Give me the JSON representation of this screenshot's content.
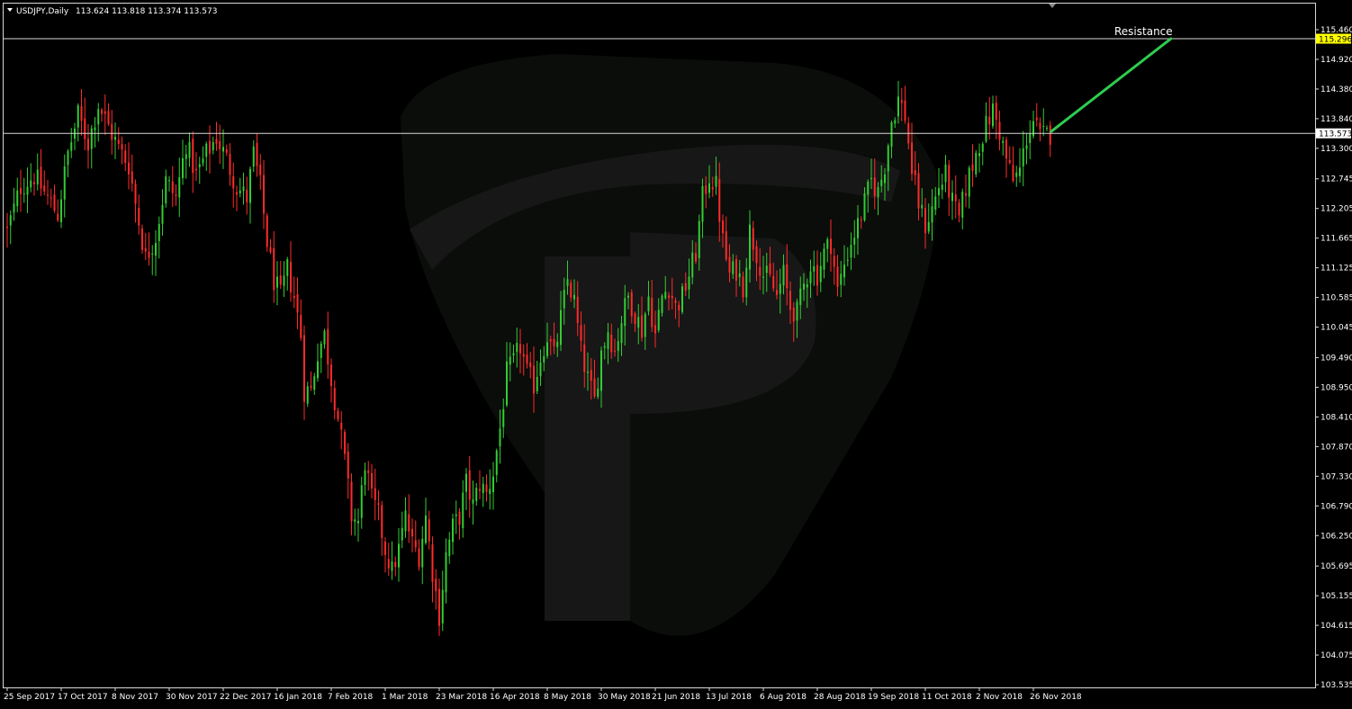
{
  "header": {
    "symbol_label": "USDJPY,Daily",
    "ohlc": "113.624 113.818 113.374 113.573"
  },
  "colors": {
    "background": "#000000",
    "frame": "#d8d8d8",
    "bull": "#32cd32",
    "bear": "#ff2a2a",
    "hline": "#d8d8d8",
    "arrow": "#2ecc4f",
    "resistance_tag_bg": "#ffff00",
    "current_tag_bg": "#ffffff",
    "watermark": "#171717"
  },
  "icons": {
    "menu": "triangle-down-icon",
    "shift_marker": "triangle-down-icon"
  },
  "chart_data": {
    "type": "candlestick",
    "title": "USDJPY,Daily",
    "ylim": [
      103.535,
      115.46
    ],
    "y_ticks": [
      "115.460",
      "114.920",
      "114.380",
      "113.840",
      "113.300",
      "112.745",
      "112.205",
      "111.665",
      "111.125",
      "110.585",
      "110.045",
      "109.490",
      "108.950",
      "108.410",
      "107.870",
      "107.330",
      "106.790",
      "106.250",
      "105.695",
      "105.155",
      "104.615",
      "104.075",
      "103.535"
    ],
    "x_tick_labels": [
      "25 Sep 2017",
      "17 Oct 2017",
      "8 Nov 2017",
      "30 Nov 2017",
      "22 Dec 2017",
      "16 Jan 2018",
      "7 Feb 2018",
      "1 Mar 2018",
      "23 Mar 2018",
      "16 Apr 2018",
      "8 May 2018",
      "30 May 2018",
      "21 Jun 2018",
      "13 Jul 2018",
      "6 Aug 2018",
      "28 Aug 2018",
      "19 Sep 2018",
      "11 Oct 2018",
      "2 Nov 2018",
      "26 Nov 2018"
    ],
    "x_tick_bar_index": [
      0,
      16,
      32,
      48,
      64,
      80,
      96,
      112,
      128,
      144,
      160,
      176,
      192,
      208,
      224,
      240,
      256,
      272,
      288,
      304
    ],
    "bar_count": 310,
    "anchors": [
      {
        "i": 0,
        "c": 111.8
      },
      {
        "i": 4,
        "c": 112.6
      },
      {
        "i": 8,
        "c": 112.8
      },
      {
        "i": 12,
        "c": 112.4
      },
      {
        "i": 15,
        "c": 112.1
      },
      {
        "i": 18,
        "c": 113.2
      },
      {
        "i": 21,
        "c": 113.9
      },
      {
        "i": 24,
        "c": 113.4
      },
      {
        "i": 27,
        "c": 114.1
      },
      {
        "i": 30,
        "c": 113.7
      },
      {
        "i": 33,
        "c": 113.3
      },
      {
        "i": 36,
        "c": 113.0
      },
      {
        "i": 38,
        "c": 112.3
      },
      {
        "i": 41,
        "c": 111.3
      },
      {
        "i": 44,
        "c": 111.7
      },
      {
        "i": 47,
        "c": 112.7
      },
      {
        "i": 50,
        "c": 112.4
      },
      {
        "i": 53,
        "c": 113.4
      },
      {
        "i": 56,
        "c": 112.8
      },
      {
        "i": 59,
        "c": 113.2
      },
      {
        "i": 62,
        "c": 113.5
      },
      {
        "i": 65,
        "c": 113.1
      },
      {
        "i": 68,
        "c": 112.6
      },
      {
        "i": 71,
        "c": 112.4
      },
      {
        "i": 73,
        "c": 113.2
      },
      {
        "i": 75,
        "c": 112.6
      },
      {
        "i": 77,
        "c": 111.6
      },
      {
        "i": 79,
        "c": 110.9
      },
      {
        "i": 81,
        "c": 110.6
      },
      {
        "i": 83,
        "c": 111.1
      },
      {
        "i": 85,
        "c": 110.6
      },
      {
        "i": 87,
        "c": 109.9
      },
      {
        "i": 88,
        "c": 108.9
      },
      {
        "i": 90,
        "c": 108.9
      },
      {
        "i": 92,
        "c": 109.6
      },
      {
        "i": 94,
        "c": 109.9
      },
      {
        "i": 96,
        "c": 109.1
      },
      {
        "i": 98,
        "c": 108.4
      },
      {
        "i": 100,
        "c": 107.6
      },
      {
        "i": 102,
        "c": 106.6
      },
      {
        "i": 104,
        "c": 106.5
      },
      {
        "i": 106,
        "c": 107.6
      },
      {
        "i": 108,
        "c": 106.9
      },
      {
        "i": 110,
        "c": 106.6
      },
      {
        "i": 112,
        "c": 106.0
      },
      {
        "i": 114,
        "c": 105.6
      },
      {
        "i": 116,
        "c": 106.0
      },
      {
        "i": 118,
        "c": 106.6
      },
      {
        "i": 120,
        "c": 106.1
      },
      {
        "i": 122,
        "c": 105.9
      },
      {
        "i": 124,
        "c": 106.6
      },
      {
        "i": 126,
        "c": 105.6
      },
      {
        "i": 128,
        "c": 104.8
      },
      {
        "i": 130,
        "c": 105.9
      },
      {
        "i": 132,
        "c": 106.4
      },
      {
        "i": 134,
        "c": 106.6
      },
      {
        "i": 136,
        "c": 107.2
      },
      {
        "i": 138,
        "c": 106.8
      },
      {
        "i": 140,
        "c": 107.2
      },
      {
        "i": 142,
        "c": 107.0
      },
      {
        "i": 144,
        "c": 107.4
      },
      {
        "i": 146,
        "c": 108.2
      },
      {
        "i": 148,
        "c": 109.2
      },
      {
        "i": 150,
        "c": 109.4
      },
      {
        "i": 152,
        "c": 109.7
      },
      {
        "i": 154,
        "c": 109.2
      },
      {
        "i": 156,
        "c": 109.0
      },
      {
        "i": 158,
        "c": 109.5
      },
      {
        "i": 160,
        "c": 109.9
      },
      {
        "i": 162,
        "c": 109.5
      },
      {
        "i": 164,
        "c": 110.2
      },
      {
        "i": 166,
        "c": 110.9
      },
      {
        "i": 168,
        "c": 110.5
      },
      {
        "i": 170,
        "c": 109.6
      },
      {
        "i": 172,
        "c": 109.1
      },
      {
        "i": 174,
        "c": 108.7
      },
      {
        "i": 176,
        "c": 109.6
      },
      {
        "i": 178,
        "c": 110.0
      },
      {
        "i": 180,
        "c": 109.6
      },
      {
        "i": 182,
        "c": 110.2
      },
      {
        "i": 184,
        "c": 110.6
      },
      {
        "i": 186,
        "c": 110.3
      },
      {
        "i": 188,
        "c": 110.0
      },
      {
        "i": 190,
        "c": 110.6
      },
      {
        "i": 192,
        "c": 109.9
      },
      {
        "i": 194,
        "c": 110.6
      },
      {
        "i": 196,
        "c": 110.8
      },
      {
        "i": 198,
        "c": 110.4
      },
      {
        "i": 200,
        "c": 110.6
      },
      {
        "i": 202,
        "c": 111.0
      },
      {
        "i": 204,
        "c": 111.4
      },
      {
        "i": 206,
        "c": 112.4
      },
      {
        "i": 208,
        "c": 112.8
      },
      {
        "i": 210,
        "c": 112.6
      },
      {
        "i": 212,
        "c": 111.6
      },
      {
        "i": 214,
        "c": 111.0
      },
      {
        "i": 216,
        "c": 111.1
      },
      {
        "i": 218,
        "c": 110.8
      },
      {
        "i": 220,
        "c": 111.8
      },
      {
        "i": 222,
        "c": 111.4
      },
      {
        "i": 224,
        "c": 111.0
      },
      {
        "i": 226,
        "c": 110.9
      },
      {
        "i": 228,
        "c": 110.6
      },
      {
        "i": 230,
        "c": 111.0
      },
      {
        "i": 232,
        "c": 110.4
      },
      {
        "i": 234,
        "c": 110.3
      },
      {
        "i": 236,
        "c": 110.8
      },
      {
        "i": 238,
        "c": 111.2
      },
      {
        "i": 240,
        "c": 111.0
      },
      {
        "i": 242,
        "c": 111.4
      },
      {
        "i": 244,
        "c": 111.6
      },
      {
        "i": 246,
        "c": 110.7
      },
      {
        "i": 248,
        "c": 111.2
      },
      {
        "i": 250,
        "c": 111.6
      },
      {
        "i": 252,
        "c": 111.9
      },
      {
        "i": 254,
        "c": 112.3
      },
      {
        "i": 256,
        "c": 112.7
      },
      {
        "i": 258,
        "c": 112.5
      },
      {
        "i": 260,
        "c": 113.0
      },
      {
        "i": 262,
        "c": 113.8
      },
      {
        "i": 264,
        "c": 114.2
      },
      {
        "i": 266,
        "c": 113.9
      },
      {
        "i": 268,
        "c": 112.9
      },
      {
        "i": 270,
        "c": 112.3
      },
      {
        "i": 272,
        "c": 111.9
      },
      {
        "i": 274,
        "c": 112.2
      },
      {
        "i": 276,
        "c": 112.6
      },
      {
        "i": 278,
        "c": 112.8
      },
      {
        "i": 280,
        "c": 112.3
      },
      {
        "i": 282,
        "c": 112.0
      },
      {
        "i": 284,
        "c": 112.6
      },
      {
        "i": 286,
        "c": 113.0
      },
      {
        "i": 288,
        "c": 113.4
      },
      {
        "i": 290,
        "c": 113.7
      },
      {
        "i": 292,
        "c": 114.0
      },
      {
        "i": 294,
        "c": 113.6
      },
      {
        "i": 296,
        "c": 113.1
      },
      {
        "i": 298,
        "c": 112.7
      },
      {
        "i": 300,
        "c": 112.9
      },
      {
        "i": 302,
        "c": 113.5
      },
      {
        "i": 304,
        "c": 113.8
      },
      {
        "i": 306,
        "c": 113.5
      },
      {
        "i": 309,
        "c": 113.573
      }
    ],
    "hlines": [
      {
        "name": "resistance",
        "value": 115.296,
        "tag": "115.296"
      },
      {
        "name": "current-price",
        "value": 113.573,
        "tag": "113.573"
      }
    ],
    "arrow": {
      "from_bar": 309,
      "from_value": 113.573,
      "to_bar": 345,
      "to_value": 115.296
    },
    "annotation": {
      "text": "Resistance",
      "near": "resistance"
    }
  }
}
